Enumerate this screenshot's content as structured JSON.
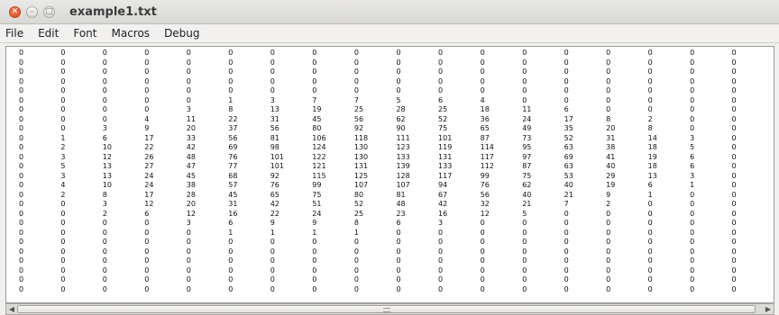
{
  "window": {
    "title": "example1.txt"
  },
  "menu": [
    "File",
    "Edit",
    "Font",
    "Macros",
    "Debug"
  ],
  "grid": [
    [
      "0",
      "0",
      "0",
      "0",
      "0",
      "0",
      "0",
      "0",
      "0",
      "0",
      "0",
      "0",
      "0",
      "0",
      "0",
      "0",
      "0",
      "0"
    ],
    [
      "0",
      "0",
      "0",
      "0",
      "0",
      "0",
      "0",
      "0",
      "0",
      "0",
      "0",
      "0",
      "0",
      "0",
      "0",
      "0",
      "0",
      "0"
    ],
    [
      "0",
      "0",
      "0",
      "0",
      "0",
      "0",
      "0",
      "0",
      "0",
      "0",
      "0",
      "0",
      "0",
      "0",
      "0",
      "0",
      "0",
      "0"
    ],
    [
      "0",
      "0",
      "0",
      "0",
      "0",
      "0",
      "0",
      "0",
      "0",
      "0",
      "0",
      "0",
      "0",
      "0",
      "0",
      "0",
      "0",
      "0"
    ],
    [
      "0",
      "0",
      "0",
      "0",
      "0",
      "0",
      "0",
      "0",
      "0",
      "0",
      "0",
      "0",
      "0",
      "0",
      "0",
      "0",
      "0",
      "0"
    ],
    [
      "0",
      "0",
      "0",
      "0",
      "0",
      "1",
      "3",
      "7",
      "7",
      "5",
      "6",
      "4",
      "0",
      "0",
      "0",
      "0",
      "0",
      "0"
    ],
    [
      "0",
      "0",
      "0",
      "0",
      "3",
      "8",
      "13",
      "19",
      "25",
      "28",
      "25",
      "18",
      "11",
      "6",
      "0",
      "0",
      "0",
      "0"
    ],
    [
      "0",
      "0",
      "0",
      "4",
      "11",
      "22",
      "31",
      "45",
      "56",
      "62",
      "52",
      "36",
      "24",
      "17",
      "8",
      "2",
      "0",
      "0"
    ],
    [
      "0",
      "0",
      "3",
      "9",
      "20",
      "37",
      "56",
      "80",
      "92",
      "90",
      "75",
      "65",
      "49",
      "35",
      "20",
      "8",
      "0",
      "0"
    ],
    [
      "0",
      "1",
      "6",
      "17",
      "33",
      "56",
      "81",
      "106",
      "118",
      "111",
      "101",
      "87",
      "73",
      "52",
      "31",
      "14",
      "3",
      "0"
    ],
    [
      "0",
      "2",
      "10",
      "22",
      "42",
      "69",
      "98",
      "124",
      "130",
      "123",
      "119",
      "114",
      "95",
      "63",
      "38",
      "18",
      "5",
      "0"
    ],
    [
      "0",
      "3",
      "12",
      "26",
      "48",
      "76",
      "101",
      "122",
      "130",
      "133",
      "131",
      "117",
      "97",
      "69",
      "41",
      "19",
      "6",
      "0"
    ],
    [
      "0",
      "5",
      "13",
      "27",
      "47",
      "77",
      "101",
      "121",
      "131",
      "139",
      "133",
      "112",
      "87",
      "63",
      "40",
      "18",
      "6",
      "0"
    ],
    [
      "0",
      "3",
      "13",
      "24",
      "45",
      "68",
      "92",
      "115",
      "125",
      "128",
      "117",
      "99",
      "75",
      "53",
      "29",
      "13",
      "3",
      "0"
    ],
    [
      "0",
      "4",
      "10",
      "24",
      "38",
      "57",
      "76",
      "99",
      "107",
      "107",
      "94",
      "76",
      "62",
      "40",
      "19",
      "6",
      "1",
      "0"
    ],
    [
      "0",
      "2",
      "8",
      "17",
      "28",
      "45",
      "65",
      "75",
      "80",
      "81",
      "67",
      "56",
      "40",
      "21",
      "9",
      "1",
      "0",
      "0"
    ],
    [
      "0",
      "0",
      "3",
      "12",
      "20",
      "31",
      "42",
      "51",
      "52",
      "48",
      "42",
      "32",
      "21",
      "7",
      "2",
      "0",
      "0",
      "0"
    ],
    [
      "0",
      "0",
      "2",
      "6",
      "12",
      "16",
      "22",
      "24",
      "25",
      "23",
      "16",
      "12",
      "5",
      "0",
      "0",
      "0",
      "0",
      "0"
    ],
    [
      "0",
      "0",
      "0",
      "0",
      "3",
      "6",
      "9",
      "9",
      "8",
      "6",
      "3",
      "0",
      "0",
      "0",
      "0",
      "0",
      "0",
      "0"
    ],
    [
      "0",
      "0",
      "0",
      "0",
      "0",
      "1",
      "1",
      "1",
      "1",
      "0",
      "0",
      "0",
      "0",
      "0",
      "0",
      "0",
      "0",
      "0"
    ],
    [
      "0",
      "0",
      "0",
      "0",
      "0",
      "0",
      "0",
      "0",
      "0",
      "0",
      "0",
      "0",
      "0",
      "0",
      "0",
      "0",
      "0",
      "0"
    ],
    [
      "0",
      "0",
      "0",
      "0",
      "0",
      "0",
      "0",
      "0",
      "0",
      "0",
      "0",
      "0",
      "0",
      "0",
      "0",
      "0",
      "0",
      "0"
    ],
    [
      "0",
      "0",
      "0",
      "0",
      "0",
      "0",
      "0",
      "0",
      "0",
      "0",
      "0",
      "0",
      "0",
      "0",
      "0",
      "0",
      "0",
      "0"
    ],
    [
      "0",
      "0",
      "0",
      "0",
      "0",
      "0",
      "0",
      "0",
      "0",
      "0",
      "0",
      "0",
      "0",
      "0",
      "0",
      "0",
      "0",
      "0"
    ],
    [
      "0",
      "0",
      "0",
      "0",
      "0",
      "0",
      "0",
      "0",
      "0",
      "0",
      "0",
      "0",
      "0",
      "0",
      "0",
      "0",
      "0",
      "0"
    ],
    [
      "0",
      "0",
      "0",
      "0",
      "0",
      "0",
      "0",
      "0",
      "0",
      "0",
      "0",
      "0",
      "0",
      "0",
      "0",
      "0",
      "0",
      "0"
    ]
  ]
}
